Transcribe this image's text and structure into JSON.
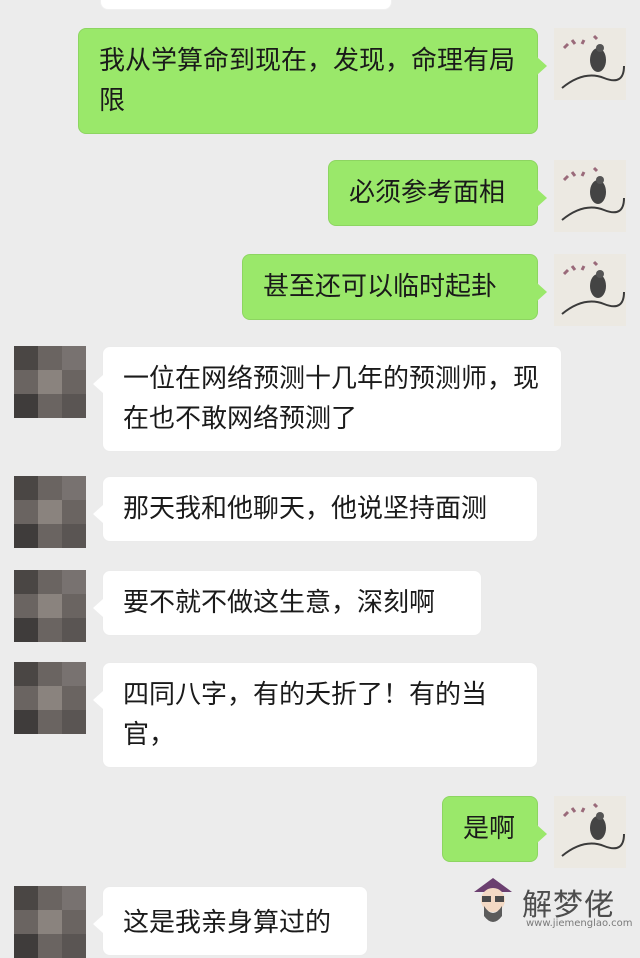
{
  "messages": [
    {
      "side": "self",
      "text": "我从学算命到现在，发现，命理有局限"
    },
    {
      "side": "self",
      "text": "必须参考面相"
    },
    {
      "side": "self",
      "text": "甚至还可以临时起卦"
    },
    {
      "side": "other",
      "text": "一位在网络预测十几年的预测师，现在也不敢网络预测了"
    },
    {
      "side": "other",
      "text": "那天我和他聊天，他说坚持面测"
    },
    {
      "side": "other",
      "text": "要不就不做这生意，深刻啊"
    },
    {
      "side": "other",
      "text": "四同八字，有的夭折了！有的当官，"
    },
    {
      "side": "self",
      "text": "是啊"
    },
    {
      "side": "other",
      "text": "这是我亲身算过的"
    }
  ],
  "watermark": {
    "brand": "解梦佬",
    "url": "www.jiemenglao.com",
    "icon": "fortune-teller-icon"
  },
  "colors": {
    "self_bubble": "#9ae86a",
    "other_bubble": "#ffffff",
    "background": "#ececec"
  }
}
